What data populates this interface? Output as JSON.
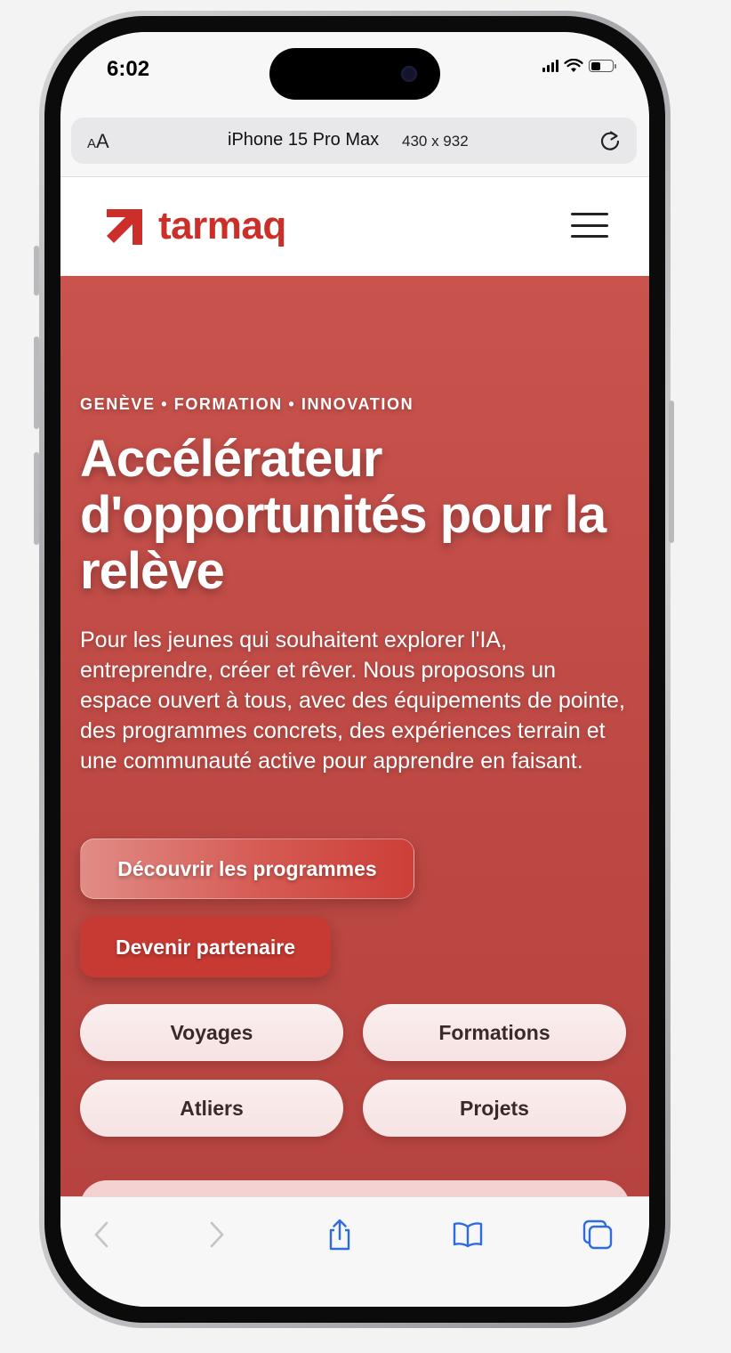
{
  "status_bar": {
    "time": "6:02"
  },
  "browser": {
    "text_size_small": "A",
    "text_size_large": "A",
    "device_name": "iPhone 15 Pro Max",
    "device_dims": "430 x 932"
  },
  "site": {
    "logo_text": "tarmaq",
    "brand_color": "#cc2f2a"
  },
  "hero": {
    "eyebrow": "GENÈVE • FORMATION • INNOVATION",
    "title": "Accélérateur d'opportunités pour la relève",
    "description": "Pour les jeunes qui souhaitent explorer l'IA, entreprendre, créer et rêver. Nous proposons un espace ouvert à tous, avec des équipements de pointe, des programmes concrets, des expériences terrain et une communauté active pour apprendre en faisant.",
    "primary_button": "Découvrir les programmes",
    "secondary_button": "Devenir partenaire",
    "chips": [
      "Voyages",
      "Formations",
      "Atliers",
      "Projets"
    ],
    "background_color": "#c24d47"
  },
  "toolbar": {
    "icons": [
      "back-icon",
      "forward-icon",
      "share-icon",
      "bookmarks-icon",
      "tabs-icon"
    ],
    "accent_color": "#2d6be0"
  }
}
